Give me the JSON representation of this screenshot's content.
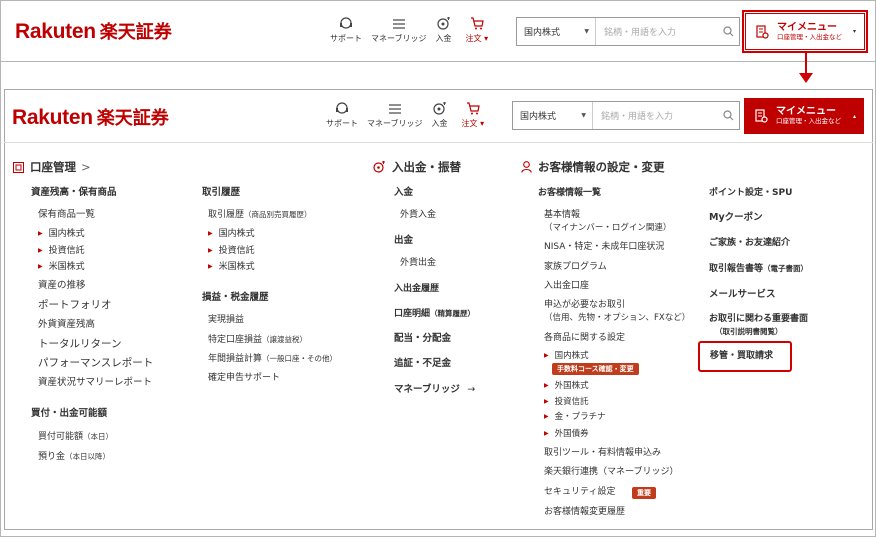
{
  "colors": {
    "brand": "#bf0000",
    "highlight": "#d00000",
    "badge": "#bf3c1c"
  },
  "logo": {
    "en": "Rakuten",
    "jp": "楽天証券"
  },
  "nav": {
    "support": {
      "label": "サポート",
      "icon": "headset-icon"
    },
    "money_bridge": {
      "label": "マネーブリッジ",
      "icon": "money-bridge-icon"
    },
    "deposit": {
      "label": "入金",
      "icon": "coin-icon"
    },
    "order": {
      "label": "注文 ▾",
      "icon": "cart-icon"
    }
  },
  "search": {
    "select_value": "国内株式",
    "placeholder": "銘柄・用語を入力",
    "icon": "search-icon"
  },
  "mypage": {
    "title": "マイメニュー",
    "subtitle": "口座管理・入出金など",
    "icon": "document-icon",
    "closed_caret": "▾",
    "open_caret": "▴"
  },
  "account": {
    "heading": "口座管理",
    "heading_chevron": ">",
    "assets": {
      "title": "資産残高・保有商品",
      "holdings": "保有商品一覧",
      "items": [
        "国内株式",
        "投資信託",
        "米国株式"
      ],
      "links": [
        "資産の推移",
        "ポートフォリオ",
        "外貨資産残高",
        "トータルリターン",
        "パフォーマンスレポート",
        "資産状況サマリーレポート"
      ]
    },
    "buying": {
      "title": "買付・出金可能額",
      "power": "買付可能額",
      "power_note": "（本日）",
      "deposit": "預り金",
      "deposit_note": "（本日以降）"
    },
    "history": {
      "title": "取引履歴",
      "main": "取引履歴",
      "main_note": "（商品別売買履歴）",
      "items": [
        "国内株式",
        "投資信託",
        "米国株式"
      ]
    },
    "pl": {
      "title": "損益・税金履歴",
      "realized": "実現損益",
      "specific": "特定口座損益",
      "specific_note": "（譲渡益税）",
      "annual": "年間損益計算",
      "annual_note": "（一般口座・その他）",
      "tax": "確定申告サポート"
    }
  },
  "funds": {
    "heading": "入出金・振替",
    "deposit": "入金",
    "fx_deposit": "外貨入金",
    "withdraw": "出金",
    "fx_withdraw": "外貨出金",
    "history": "入出金履歴",
    "statement": "口座明細",
    "statement_note": "（精算履歴）",
    "dividends": "配当・分配金",
    "margin": "追証・不足金",
    "bridge": "マネーブリッジ",
    "bridge_arrow": "→"
  },
  "customer": {
    "heading": "お客様情報の設定・変更",
    "list_title": "お客様情報一覧",
    "basic": "基本情報",
    "basic_note": "（マイナンバー・ログイン関連）",
    "nisa": "NISA・特定・未成年口座状況",
    "family": "家族プログラム",
    "io_account": "入出金口座",
    "apply": "申込が必要なお取引",
    "apply_note": "（信用、先物・オプション、FXなど）",
    "product_settings": "各商品に関する設定",
    "product_items": [
      "国内株式",
      "外国株式",
      "投資信託",
      "金・プラチナ",
      "外国債券"
    ],
    "fee_badge": "手数料コース確認・変更",
    "tools": "取引ツール・有料情報申込み",
    "bank": "楽天銀行連携（マネーブリッジ）",
    "security": "セキュリティ設定",
    "security_badge": "重要",
    "change_history": "お客様情報変更履歴"
  },
  "right": {
    "points": "ポイント設定・SPU",
    "coupon": "Myクーポン",
    "family": "ご家族・お友達紹介",
    "reports": "取引報告書等",
    "reports_note": "（電子書面）",
    "mail": "メールサービス",
    "docs": "お取引に関わる重要書面",
    "docs_note": "（取引説明書閲覧）",
    "transfer": "移管・買取請求"
  }
}
